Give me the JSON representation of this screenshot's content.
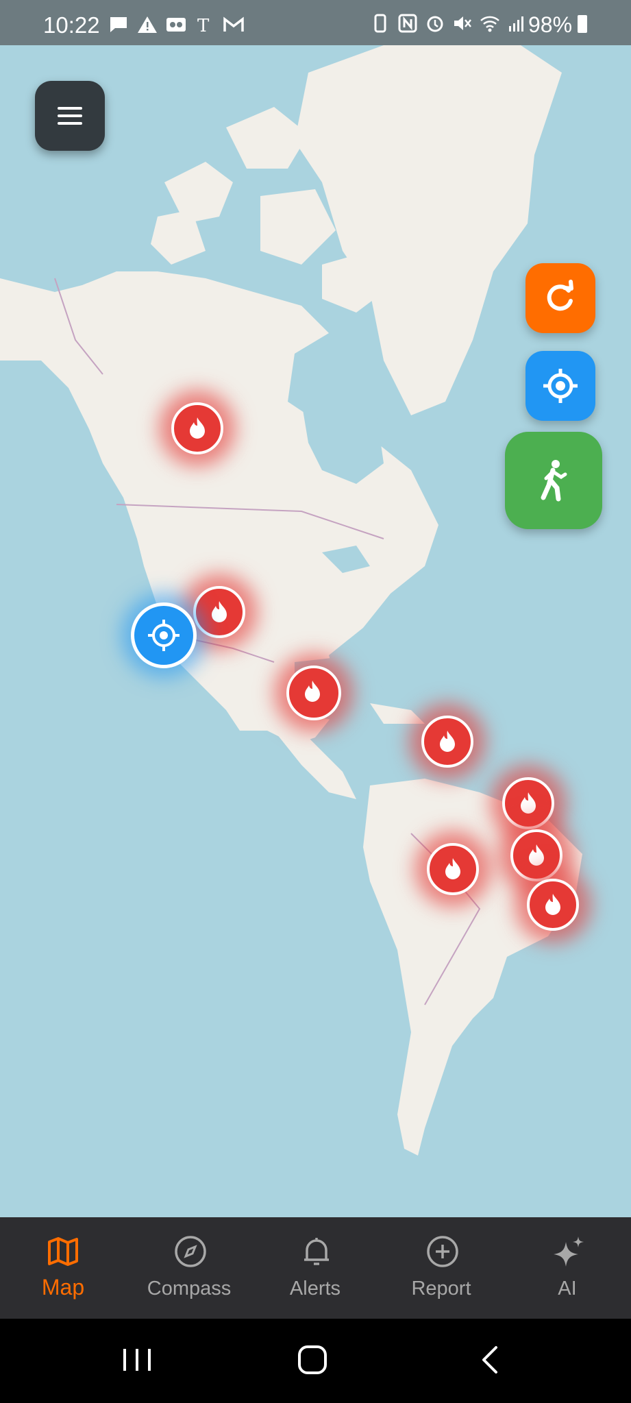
{
  "status_bar": {
    "time": "10:22",
    "battery": "98%"
  },
  "map": {
    "menu_button": "menu",
    "buttons": {
      "refresh": "refresh-icon",
      "locate": "locate-icon",
      "walk": "walk-icon"
    }
  },
  "bottom_nav": {
    "items": [
      {
        "label": "Map",
        "icon": "map-icon",
        "active": true
      },
      {
        "label": "Compass",
        "icon": "compass-icon",
        "active": false
      },
      {
        "label": "Alerts",
        "icon": "bell-icon",
        "active": false
      },
      {
        "label": "Report",
        "icon": "plus-circle-icon",
        "active": false
      },
      {
        "label": "AI",
        "icon": "sparkle-icon",
        "active": false
      }
    ]
  },
  "colors": {
    "accent_orange": "#ff6d00",
    "locate_blue": "#2196f3",
    "walk_green": "#4caf50",
    "fire_red": "#e53935",
    "nav_bg": "#2d2d30",
    "map_water": "#aad3df",
    "map_land": "#f2efe9"
  }
}
